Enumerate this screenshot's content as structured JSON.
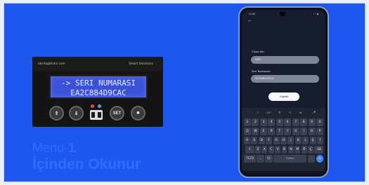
{
  "colors": {
    "background": "#1e57f0",
    "headline": "#2d70ff",
    "lcd": "#3c52d6",
    "send_button": "#3f86ff"
  },
  "device": {
    "site": "oksitogktima.com",
    "brand": "Smart Solutions",
    "lcd_line1": "-> SERI NUMARASI",
    "lcd_line2": "EA2C884D9CAC",
    "keys": [
      {
        "icon": "double-chevron-up-icon",
        "glyph": "⇑"
      },
      {
        "icon": "double-chevron-down-icon",
        "glyph": "⇓"
      },
      {
        "label": "SET"
      },
      {
        "icon": "stop-icon",
        "glyph": "■"
      }
    ]
  },
  "headline": {
    "menu_word": "Menu-",
    "menu_number": "1",
    "line2": "İçinden Okunur"
  },
  "phone": {
    "status_time": "12:48",
    "status_icons": "▪ ◔ ▮",
    "back_glyph": "←",
    "field1_label": "Cihaz Adı",
    "field1_value": "SMIT",
    "field2_label": "Seri Numarası",
    "field2_value": "EA2C884D9CAC",
    "submit_label": "Kaydet",
    "keyboard": {
      "toolbar": [
        "⋮⋮",
        "☺",
        "GIF",
        "⚙",
        "G",
        "⇄",
        "🎤"
      ],
      "row_num": [
        "1",
        "2",
        "3",
        "4",
        "5",
        "6",
        "7",
        "8",
        "9",
        "0"
      ],
      "row_1": [
        "Q",
        "W",
        "E",
        "R",
        "T",
        "Y",
        "U",
        "I",
        "O",
        "P"
      ],
      "row_2": [
        "A",
        "S",
        "D",
        "F",
        "G",
        "H",
        "J",
        "K",
        "L",
        "Ş",
        "İ"
      ],
      "row_3": [
        "⇧",
        "Z",
        "X",
        "C",
        "V",
        "B",
        "N",
        "M",
        "Ö",
        "Ç",
        "⌫"
      ],
      "row_4_left": "?123",
      "row_4_comma": ",",
      "row_4_emoji": "☺",
      "row_4_space": "Türkçe",
      "row_4_dot": ".",
      "row_4_go": "➜"
    }
  }
}
